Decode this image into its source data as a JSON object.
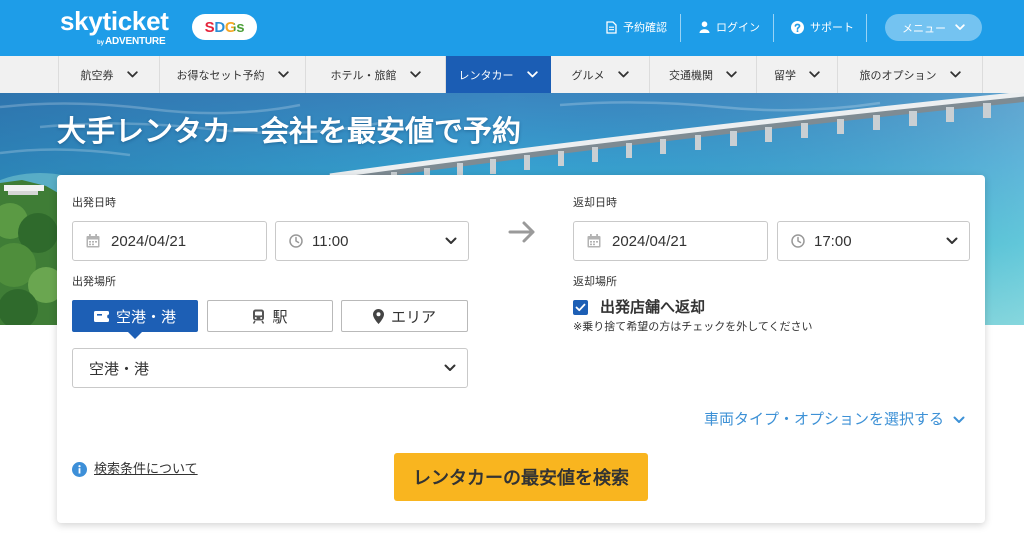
{
  "header": {
    "logo": "skyticket",
    "logo_by": "by",
    "logo_brand": "ADVENTURE",
    "sdgs_badge": "SDGs",
    "links": [
      {
        "label": "予約確認",
        "icon": "document-icon"
      },
      {
        "label": "ログイン",
        "icon": "person-icon"
      },
      {
        "label": "サポート",
        "icon": "question-circle-icon"
      }
    ],
    "menu_label": "メニュー"
  },
  "nav": {
    "items": [
      {
        "label": "航空券",
        "active": false
      },
      {
        "label": "お得なセット予約",
        "active": false
      },
      {
        "label": "ホテル・旅館",
        "active": false
      },
      {
        "label": "レンタカー",
        "active": true
      },
      {
        "label": "グルメ",
        "active": false
      },
      {
        "label": "交通機関",
        "active": false
      },
      {
        "label": "留学",
        "active": false
      },
      {
        "label": "旅のオプション",
        "active": false
      }
    ]
  },
  "hero": {
    "title": "大手レンタカー会社を最安値で予約"
  },
  "search": {
    "departure": {
      "label": "出発日時",
      "date": "2024/04/21",
      "time": "11:00"
    },
    "return": {
      "label": "返却日時",
      "date": "2024/04/21",
      "time": "17:00"
    },
    "departure_place": {
      "label": "出発場所",
      "tabs": [
        {
          "label": "空港・港",
          "icon": "ticket-icon",
          "active": true
        },
        {
          "label": "駅",
          "icon": "train-icon",
          "active": false
        },
        {
          "label": "エリア",
          "icon": "map-pin-icon",
          "active": false
        }
      ],
      "selected": "空港・港"
    },
    "return_place": {
      "label": "返却場所",
      "same_store_label": "出発店舗へ返却",
      "same_store_checked": true,
      "note": "※乗り捨て希望の方はチェックを外してください"
    },
    "options_link": "車両タイプ・オプションを選択する",
    "info_link": "検索条件について",
    "submit_label": "レンタカーの最安値を検索"
  },
  "colors": {
    "header": "#1e9de8",
    "nav_active": "#1b5db4",
    "primary": "#1d5fb5",
    "link": "#3d91d6",
    "search_button": "#f9b51f"
  }
}
